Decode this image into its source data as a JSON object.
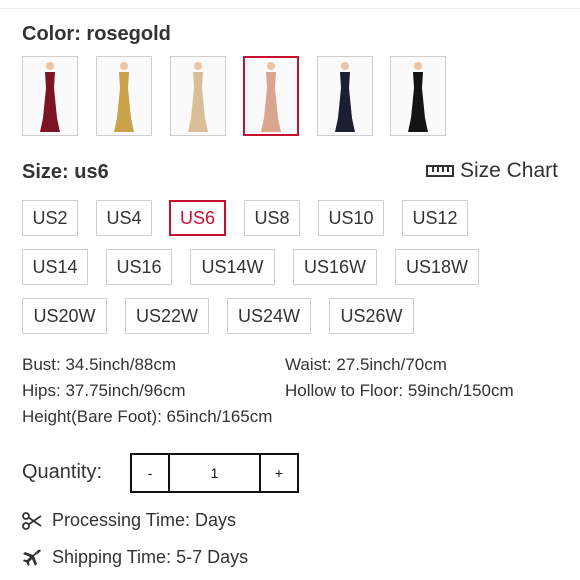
{
  "color": {
    "heading": "Color: rosegold",
    "swatches": [
      {
        "name": "burgundy",
        "dress": "#7d1424",
        "skin": "#e8c4a8",
        "selected": false
      },
      {
        "name": "gold",
        "dress": "#c9a24a",
        "skin": "#e8c4a8",
        "selected": false
      },
      {
        "name": "champagne",
        "dress": "#d8bf98",
        "skin": "#e8c4a8",
        "selected": false
      },
      {
        "name": "rosegold",
        "dress": "#d9a58e",
        "skin": "#e8c4a8",
        "selected": true
      },
      {
        "name": "navy",
        "dress": "#1b1f33",
        "skin": "#e8c4a8",
        "selected": false
      },
      {
        "name": "black",
        "dress": "#141414",
        "skin": "#e8c4a8",
        "selected": false
      }
    ]
  },
  "size": {
    "heading": "Size: us6",
    "chart_label": "Size Chart",
    "options": [
      "US2",
      "US4",
      "US6",
      "US8",
      "US10",
      "US12",
      "US14",
      "US16",
      "US14W",
      "US16W",
      "US18W",
      "US20W",
      "US22W",
      "US24W",
      "US26W"
    ],
    "selected": "US6"
  },
  "specs": {
    "bust": "Bust: 34.5inch/88cm",
    "waist": "Waist: 27.5inch/70cm",
    "hips": "Hips: 37.75inch/96cm",
    "hollow": "Hollow to Floor: 59inch/150cm",
    "height": "Height(Bare Foot): 65inch/165cm"
  },
  "quantity": {
    "label": "Quantity:",
    "minus": "-",
    "value": "1",
    "plus": "+"
  },
  "processing": {
    "icon": "scissors-icon",
    "text": "Processing Time: Days"
  },
  "shipping": {
    "icon": "airplane-icon",
    "text": "Shipping Time: 5-7 Days"
  },
  "accent": "#c8102e"
}
